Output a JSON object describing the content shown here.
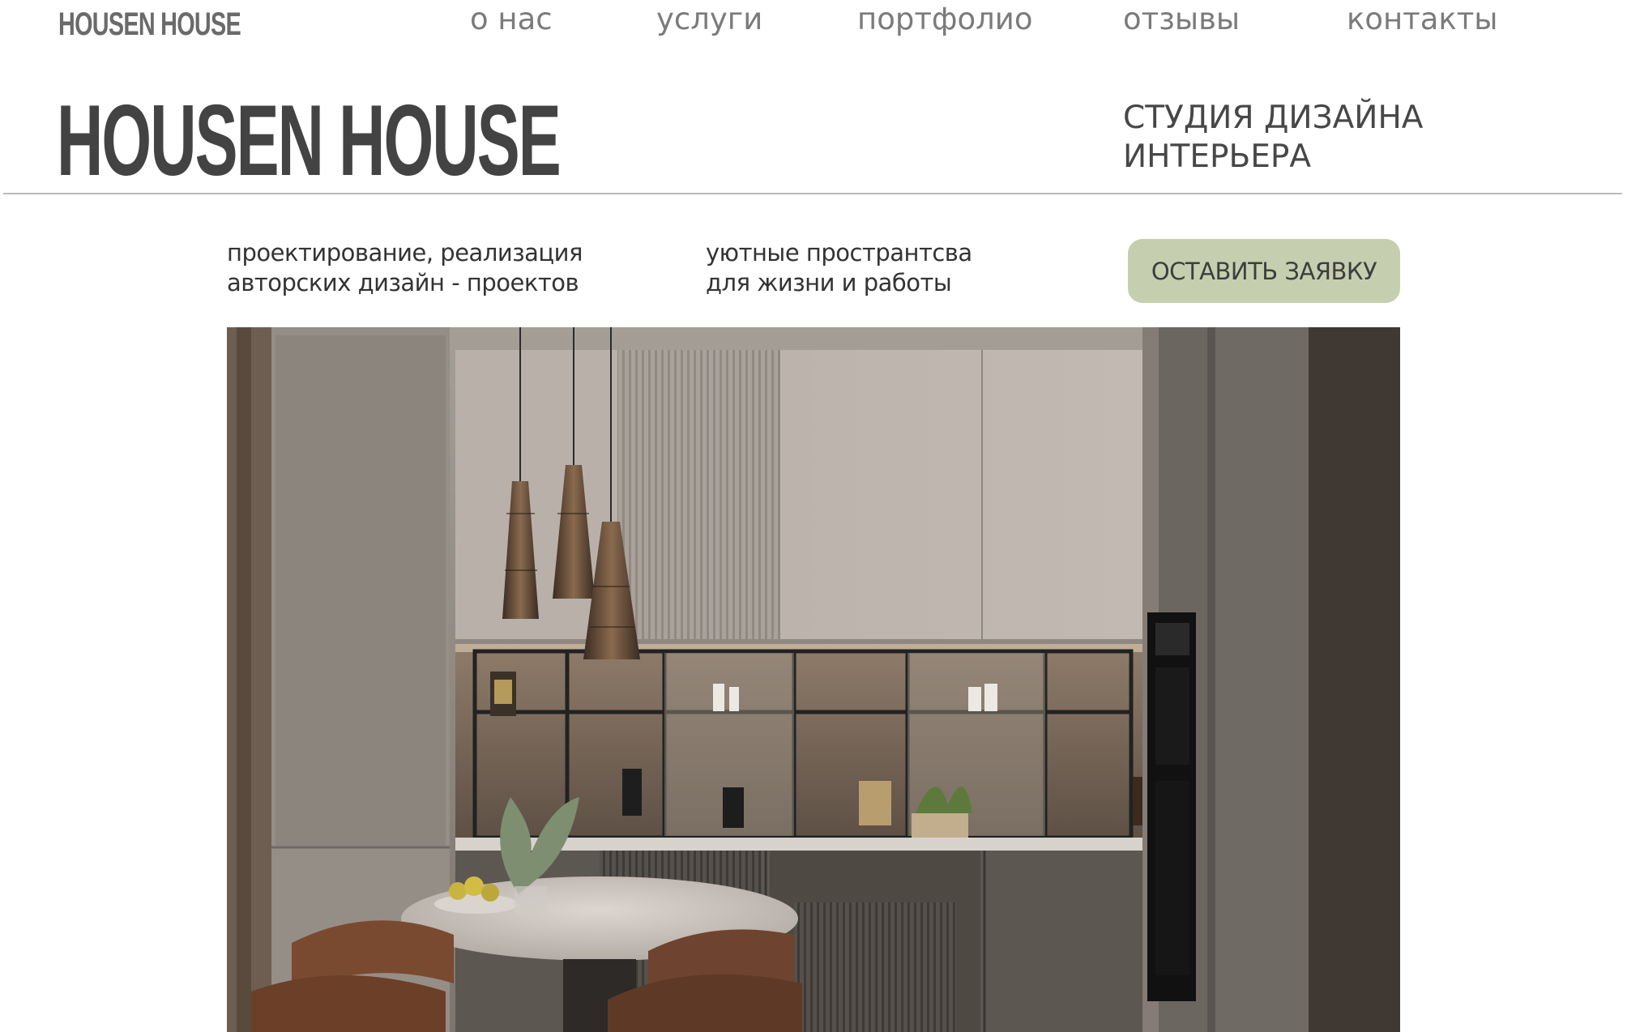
{
  "header": {
    "logo_small": "HOUSEN HOUSE",
    "nav": [
      "о нас",
      "услуги",
      "портфолио",
      "отзывы",
      "контакты"
    ]
  },
  "hero_header": {
    "logo_big": "HOUSEN HOUSE",
    "studio_line1": "СТУДИЯ ДИЗАЙНА",
    "studio_line2": "ИНТЕРЬЕРА"
  },
  "intro": {
    "tag1_line1": "проектирование, реализация",
    "tag1_line2": "авторских дизайн - проектов",
    "tag2_line1": "уютные пространтсва",
    "tag2_line2": "для жизни и работы",
    "cta_label": "ОСТАВИТЬ ЗАЯВКУ"
  },
  "colors": {
    "accent": "#c5cfaf",
    "text": "#454545",
    "nav": "#7b7b7b"
  },
  "hero_image": {
    "icon": "kitchen-interior-photo"
  }
}
